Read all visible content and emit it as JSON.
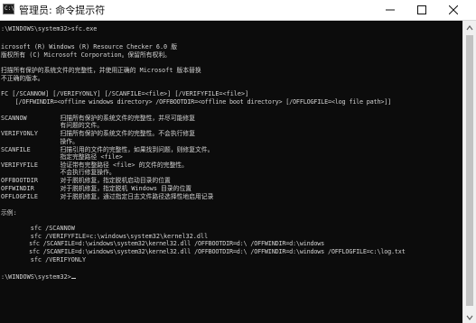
{
  "window": {
    "title": "管理员: 命令提示符",
    "icon_text": "C:\\",
    "minimize_icon": "minimize-icon",
    "maximize_icon": "maximize-icon",
    "close_icon": "close-icon"
  },
  "console": {
    "lines": [
      ":\\WINDOWS\\system32>sfc.exe",
      "",
      "icrosoft (R) Windows (R) Resource Checker 6.0 版",
      "版权所有 (C) Microsoft Corporation。保留所有权利。",
      "",
      "扫描所有保护的系统文件的完整性，并使用正确的 Microsoft 版本替换",
      "不正确的版本。",
      "",
      "FC [/SCANNOW] [/VERIFYONLY] [/SCANFILE=<file>] [/VERIFYFILE=<file>]",
      "    [/OFFWINDIR=<offline windows directory> /OFFBOOTDIR=<offline boot directory> [/OFFLOGFILE=<log file path>]]",
      "",
      "SCANNOW         扫描所有保护的系统文件的完整性，并尽可能修复",
      "                有问题的文件。",
      "VERIFYONLY      扫描所有保护的系统文件的完整性。不会执行修复",
      "                操作。",
      "SCANFILE        扫描引用的文件的完整性，如果找到问题，则修复文件。",
      "                指定完整路径 <file>",
      "VERIFYFILE      验证带有完整路径 <file> 的文件的完整性。",
      "                不会执行修复操作。",
      "OFFBOOTDIR      对于脱机修复，指定脱机启动目录的位置",
      "OFFWINDIR       对于脱机修复，指定脱机 Windows 目录的位置",
      "OFFLOGFILE      对于脱机修复，通过指定日志文件路径选择性地启用记录",
      "",
      "示例:",
      "",
      "        sfc /SCANNOW",
      "        sfc /VERIFYFILE=c:\\windows\\system32\\kernel32.dll",
      "        sfc /SCANFILE=d:\\windows\\system32\\kernel32.dll /OFFBOOTDIR=d:\\ /OFFWINDIR=d:\\windows",
      "        sfc /SCANFILE=d:\\windows\\system32\\kernel32.dll /OFFBOOTDIR=d:\\ /OFFWINDIR=d:\\windows /OFFLOGFILE=c:\\log.txt",
      "        sfc /VERIFYONLY",
      "",
      ":\\WINDOWS\\system32>"
    ]
  },
  "colors": {
    "console_bg": "#0c0c0c",
    "console_fg": "#d4d4d4",
    "titlebar_bg": "#ffffff"
  }
}
